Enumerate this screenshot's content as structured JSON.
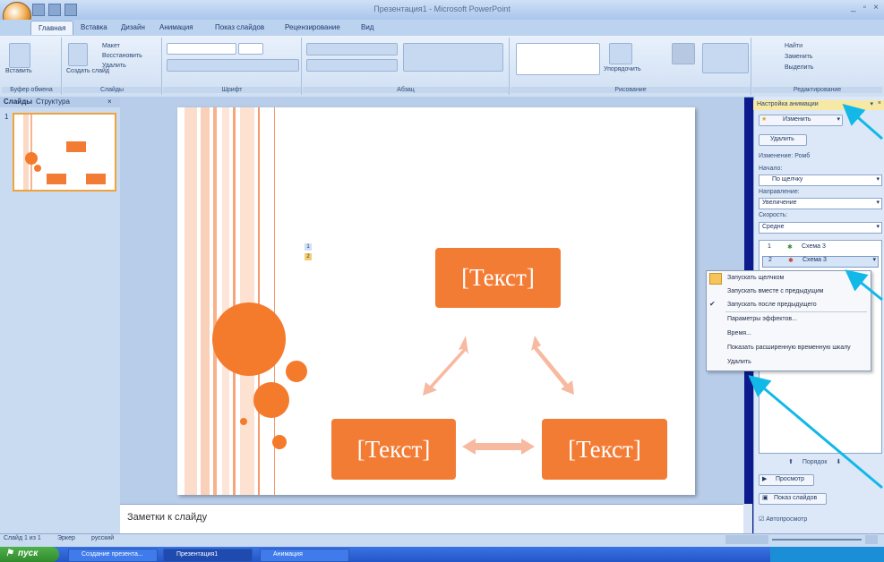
{
  "window": {
    "title": "Презентация1 - Microsoft PowerPoint",
    "controls": [
      "_",
      "▫",
      "×"
    ]
  },
  "ribbon": {
    "tabs": [
      "Главная",
      "Вставка",
      "Дизайн",
      "Анимация",
      "Показ слайдов",
      "Рецензирование",
      "Вид"
    ],
    "active_tab": "Главная",
    "groups": [
      "Буфер обмена",
      "Слайды",
      "Шрифт",
      "Абзац",
      "Рисование",
      "Редактирование"
    ],
    "buttons": {
      "paste": "Вставить",
      "new_slide": "Создать слайд",
      "layout": "Макет",
      "restore": "Восстановить",
      "delete": "Удалить",
      "arrange": "Упорядочить",
      "find": "Найти",
      "replace": "Заменить",
      "select": "Выделить"
    }
  },
  "left_panel": {
    "tabs": [
      "Слайды",
      "Структура"
    ],
    "slide_number": "1"
  },
  "slide": {
    "boxes": [
      "[Текст]",
      "[Текст]",
      "[Текст]"
    ],
    "markers": [
      "1",
      "2"
    ]
  },
  "notes": {
    "placeholder": "Заметки к слайду"
  },
  "task_pane": {
    "title": "Настройка анимации",
    "change_button": "Изменить",
    "delete_button": "Удалить",
    "effect_name": "Изменение: Ромб",
    "start_label": "Начало:",
    "start_value": "По щелчку",
    "direction_label": "Направление:",
    "direction_value": "Увеличение",
    "speed_label": "Скорость:",
    "speed_value": "Средне",
    "items": [
      {
        "num": "1",
        "label": "Схема 3"
      },
      {
        "num": "2",
        "label": "Схема 3"
      }
    ],
    "order_label": "Порядок",
    "preview_button": "Просмотр",
    "slideshow_button": "Показ слайдов",
    "autopreview_label": "Автопросмотр"
  },
  "context_menu": {
    "items": [
      "Запускать щелчком",
      "Запускать вместе с предыдущим",
      "Запускать после предыдущего",
      "Параметры эффектов...",
      "Время...",
      "Показать расширенную временную шкалу",
      "Удалить"
    ]
  },
  "status_bar": {
    "slide_info": "Слайд 1 из 1",
    "theme": "Эркер",
    "language": "русский"
  },
  "taskbar": {
    "start": "пуск",
    "tasks": [
      "Создание презента...",
      "Презентация1",
      "Анимация"
    ]
  },
  "colors": {
    "accent": "#f37c35",
    "pointer_arrows": "#12b8e8",
    "desktop": "#0b1a8c"
  }
}
